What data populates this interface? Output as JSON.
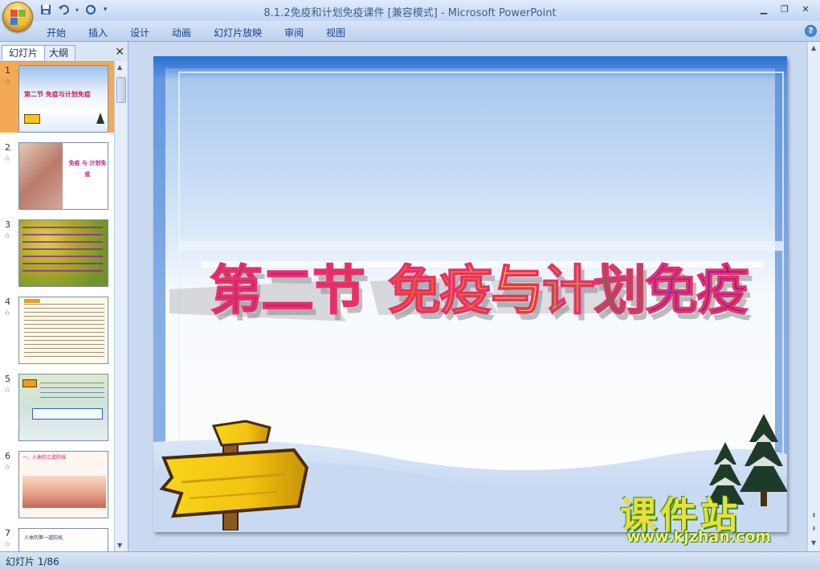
{
  "window": {
    "title": "8.1.2免疫和计划免疫课件 [兼容模式] - Microsoft PowerPoint"
  },
  "ribbon": {
    "tabs": [
      "开始",
      "插入",
      "设计",
      "动画",
      "幻灯片放映",
      "审阅",
      "视图"
    ]
  },
  "panel": {
    "tab_slides": "幻灯片",
    "tab_outline": "大纲",
    "thumbnails": [
      {
        "num": "1",
        "text": "第二节 免疫与计划免疫"
      },
      {
        "num": "2",
        "text": "免疫 与 计划免疫"
      },
      {
        "num": "3",
        "text": ""
      },
      {
        "num": "4",
        "text": ""
      },
      {
        "num": "5",
        "text": ""
      },
      {
        "num": "6",
        "text": "一、人体的三道防线"
      },
      {
        "num": "7",
        "text": "人体的第一道防线"
      }
    ]
  },
  "slide": {
    "title_chars": [
      "第",
      "二",
      "节",
      " ",
      "免",
      "疫",
      "与",
      "计",
      "划",
      "免",
      "疫"
    ],
    "title_colors": [
      "#a0258c",
      "#c0208c",
      "#e0305a",
      "",
      "#f07010",
      "#f09a10",
      "#f5d010",
      "#8cc020",
      "#2a8c40",
      "#6030b0",
      "#5020a8"
    ]
  },
  "status": {
    "slide_info": "幻灯片 1/86"
  },
  "watermark": {
    "main": "课件站",
    "url": "www.kjzhan.com"
  },
  "colors": {
    "selected_thumb": "#f4a955",
    "sky": "#aecbee"
  }
}
